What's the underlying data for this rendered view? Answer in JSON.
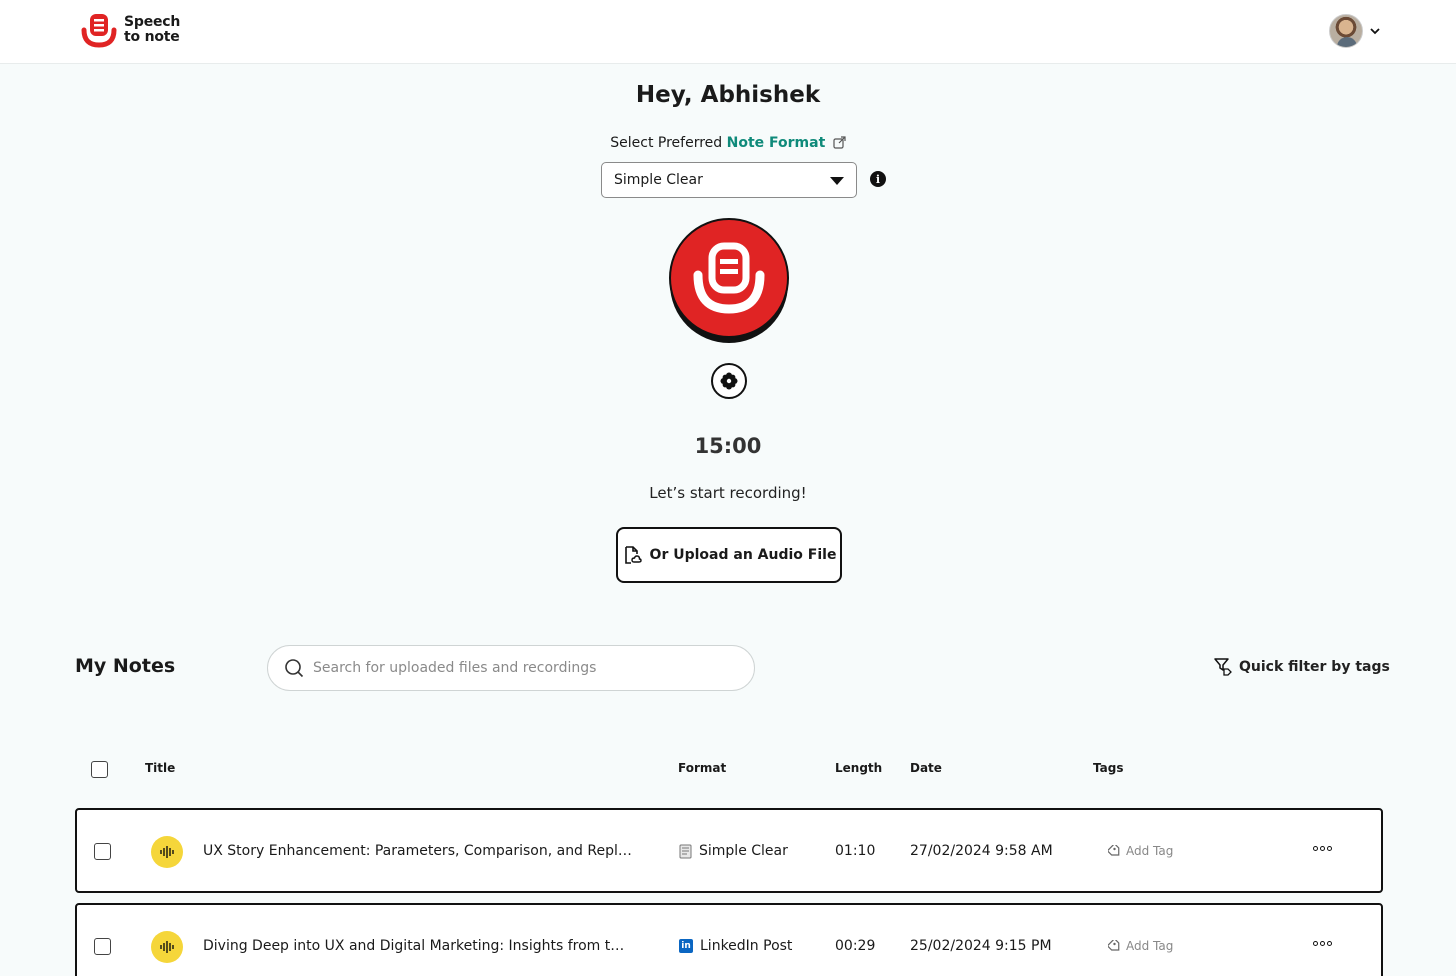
{
  "app": {
    "logo_line1": "Speech",
    "logo_line2": "to note"
  },
  "header": {
    "greeting": "Hey, Abhishek"
  },
  "format": {
    "label_prefix": "Select Preferred ",
    "label_link": "Note Format",
    "selected": "Simple Clear"
  },
  "recorder": {
    "timer": "15:00",
    "prompt": "Let’s start recording!",
    "upload_label": "Or Upload an Audio File"
  },
  "notes": {
    "title": "My Notes",
    "search_placeholder": "Search for uploaded files and recordings",
    "quick_filter_label": "Quick filter by tags",
    "columns": {
      "title": "Title",
      "format": "Format",
      "length": "Length",
      "date": "Date",
      "tags": "Tags"
    },
    "rows": [
      {
        "title": "UX Story Enhancement: Parameters, Comparison, and Repli...",
        "format": "Simple Clear",
        "format_icon": "document-icon",
        "length": "01:10",
        "date": "27/02/2024 9:58 AM",
        "tag_label": "Add Tag"
      },
      {
        "title": "Diving Deep into UX and Digital Marketing: Insights from the...",
        "format": "LinkedIn Post",
        "format_icon": "linkedin-icon",
        "length": "00:29",
        "date": "25/02/2024 9:15 PM",
        "tag_label": "Add Tag"
      }
    ]
  },
  "colors": {
    "brand_red": "#e02424",
    "accent_teal": "#0f8a7a",
    "wave_yellow": "#f5d63a"
  }
}
